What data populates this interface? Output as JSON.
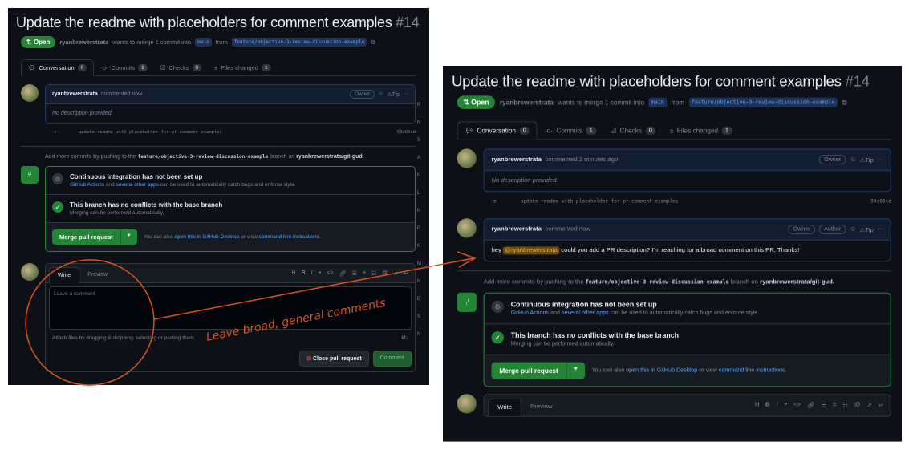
{
  "pr": {
    "title": "Update the readme with placeholders for comment examples",
    "number": "#14",
    "state": "Open",
    "author": "ryanbrewerstrata",
    "merge_text": "wants to merge 1 commit into",
    "base": "main",
    "from": "from",
    "head": "feature/objective-3-review-discussion-example"
  },
  "tabs": [
    {
      "label": "Conversation",
      "count": "0"
    },
    {
      "label": "Commits",
      "count": "1"
    },
    {
      "label": "Checks",
      "count": "0"
    },
    {
      "label": "Files changed",
      "count": "1"
    }
  ],
  "left": {
    "comment": {
      "author": "ryanbrewerstrata",
      "action": "commented now",
      "badge": "Owner",
      "body": "No description provided."
    },
    "sidebar": [
      "R",
      "N",
      "S",
      "A",
      "N",
      "L",
      "N",
      "P",
      "N",
      "M",
      "N",
      "D",
      "S",
      "N"
    ]
  },
  "right": {
    "comment1": {
      "author": "ryanbrewerstrata",
      "action": "commented 2 minutes ago",
      "badge": "Owner",
      "body": "No description provided."
    },
    "comment2": {
      "author": "ryanbrewerstrata",
      "action": "commented now",
      "badges": [
        "Owner",
        "Author"
      ],
      "body_pre": "hey",
      "mention": "@ryanbrewerstrata",
      "body_post": "could you add a PR description? I'm reaching for a broad comment on this PR. Thanks!"
    }
  },
  "tip": "Tip",
  "commit": {
    "message": "update readme with placeholder for pr comment examples",
    "sha": "59a66cd"
  },
  "add_more": {
    "pre": "Add more commits by pushing to the",
    "branch": "feature/objective-3-review-discussion-example",
    "mid": "branch on",
    "repo": "ryanbrewerstrata/git-gud."
  },
  "ci": {
    "title": "Continuous integration has not been set up",
    "link1": "GitHub Actions",
    "and": "and",
    "link2": "several other apps",
    "rest": "can be used to automatically catch bugs and enforce style."
  },
  "conflicts": {
    "title": "This branch has no conflicts with the base branch",
    "sub": "Merging can be performed automatically."
  },
  "merge": {
    "button": "Merge pull request",
    "also": "You can also",
    "link1": "open this in GitHub Desktop",
    "or": "or view",
    "link2": "command line instructions."
  },
  "editor": {
    "write": "Write",
    "preview": "Preview",
    "placeholder": "Leave a comment",
    "attach": "Attach files by dragging & dropping, selecting or pasting them.",
    "close": "Close pull request",
    "comment": "Comment"
  },
  "annotation": "Leave broad, general comments",
  "colors": {
    "annotation": "#d9541a",
    "green": "#238636",
    "link": "#58a6ff"
  }
}
